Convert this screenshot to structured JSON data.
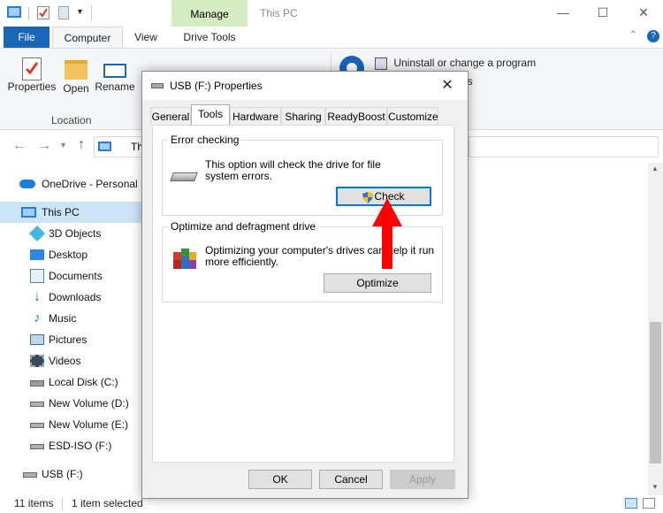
{
  "window": {
    "title": "This PC",
    "manage_tab": "Manage",
    "drive_tools_tab": "Drive Tools"
  },
  "ribbon": {
    "tabs": [
      "File",
      "Computer",
      "View"
    ],
    "buttons": [
      {
        "label": "Properties",
        "icon": "properties-icon"
      },
      {
        "label": "Open",
        "icon": "folder-icon"
      },
      {
        "label": "Rename",
        "icon": "rename-icon"
      }
    ],
    "group_label": "Location",
    "uninstall_label": "Uninstall or change a program",
    "partial_label": "es"
  },
  "address": {
    "partial_path": "Th"
  },
  "nav": {
    "items": [
      {
        "label": "OneDrive - Personal",
        "icon": "onedrive-icon"
      },
      {
        "label": "This PC",
        "icon": "this-pc-icon"
      },
      {
        "label": "3D Objects",
        "icon": "3d-objects-icon"
      },
      {
        "label": "Desktop",
        "icon": "desktop-icon"
      },
      {
        "label": "Documents",
        "icon": "documents-icon"
      },
      {
        "label": "Downloads",
        "icon": "downloads-icon"
      },
      {
        "label": "Music",
        "icon": "music-icon"
      },
      {
        "label": "Pictures",
        "icon": "pictures-icon"
      },
      {
        "label": "Videos",
        "icon": "videos-icon"
      },
      {
        "label": "Local Disk (C:)",
        "icon": "drive-icon"
      },
      {
        "label": "New Volume (D:)",
        "icon": "drive-icon"
      },
      {
        "label": "New Volume (E:)",
        "icon": "drive-icon"
      },
      {
        "label": "ESD-ISO (F:)",
        "icon": "drive-icon"
      },
      {
        "label": "USB (F:)",
        "icon": "usb-drive-icon"
      }
    ]
  },
  "status": {
    "items_count": "11 items",
    "selected": "1 item selected"
  },
  "dialog": {
    "title": "USB (F:) Properties",
    "tabs": [
      "General",
      "Tools",
      "Hardware",
      "Sharing",
      "ReadyBoost",
      "Customize"
    ],
    "active_tab": "Tools",
    "error_checking": {
      "title": "Error checking",
      "text_line1": "This option will check the drive for file",
      "text_line2": "system errors.",
      "button": "Check"
    },
    "optimize": {
      "title": "Optimize and defragment drive",
      "text_line1": "Optimizing your computer's drives can help it run",
      "text_line2": "more efficiently.",
      "button": "Optimize"
    },
    "footer": {
      "ok": "OK",
      "cancel": "Cancel",
      "apply": "Apply"
    }
  },
  "colors": {
    "file_tab": "#1b65b8",
    "manage_tab": "#d5ecc3",
    "selected_nav": "#cce4f7",
    "arrow": "#ff0000"
  }
}
